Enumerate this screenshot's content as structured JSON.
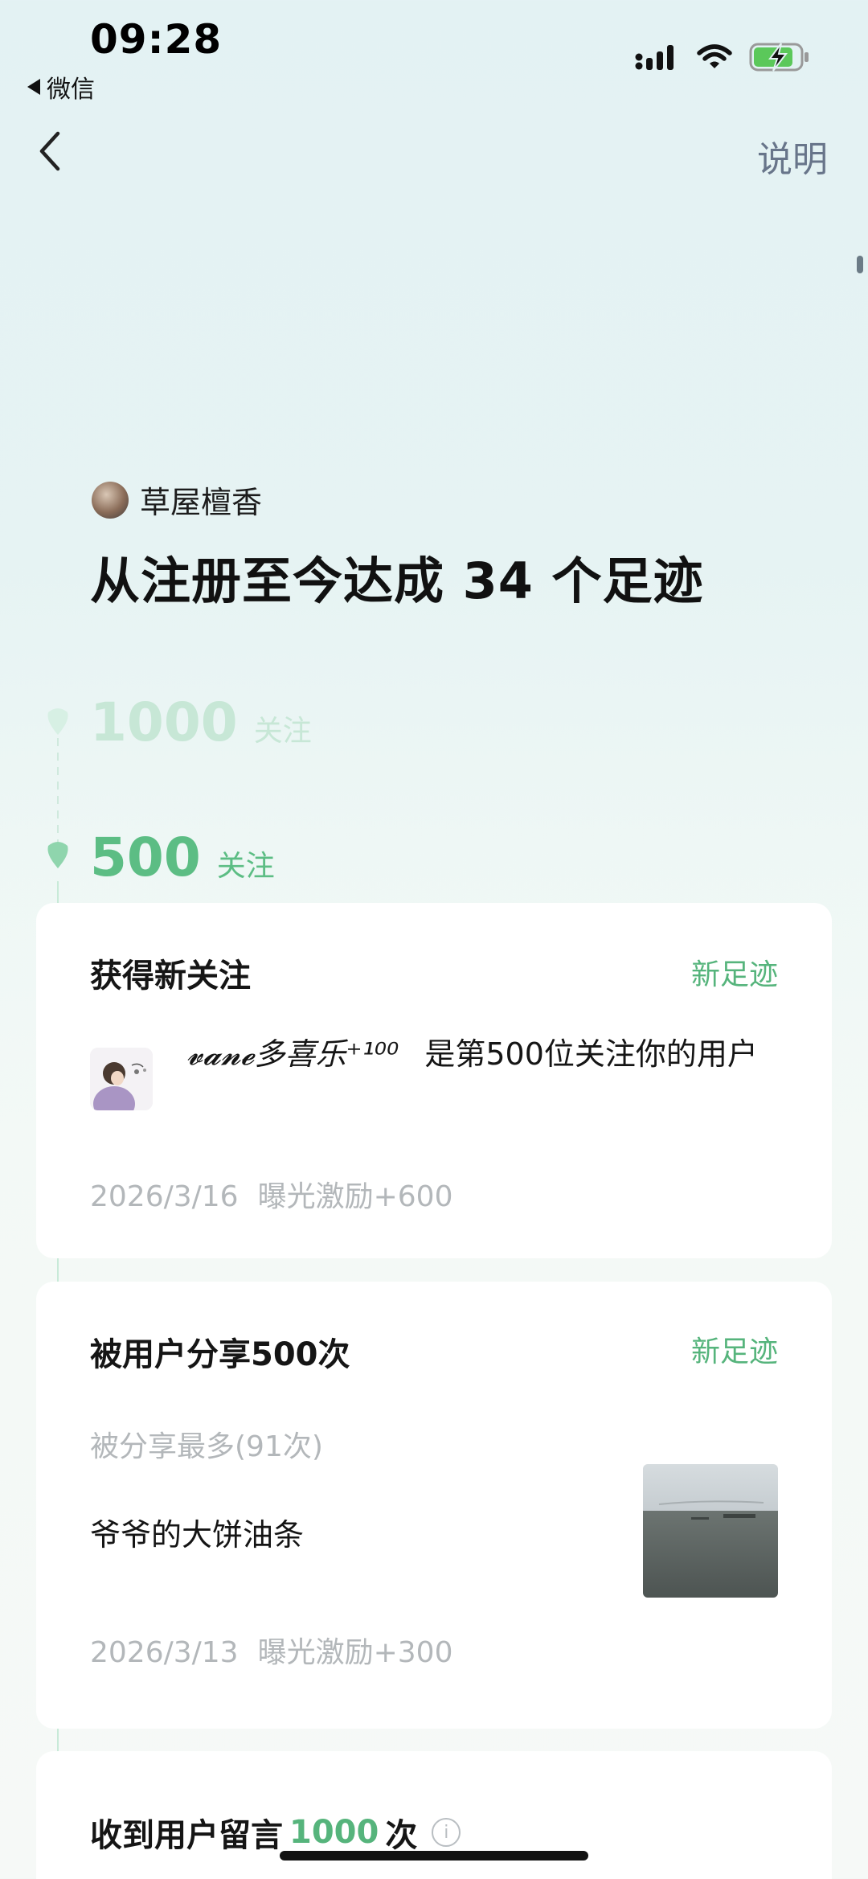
{
  "status_bar": {
    "time": "09:28",
    "back_app": "微信",
    "icons": [
      "signal-icon",
      "wifi-icon",
      "battery-charging-icon"
    ]
  },
  "nav": {
    "back_icon": "chevron-left-icon",
    "help_label": "说明"
  },
  "header": {
    "user_name": "草屋檀香",
    "headline": "从注册至今达成 34 个足迹"
  },
  "milestones": [
    {
      "number": "1000",
      "unit": "关注",
      "state": "upcoming"
    },
    {
      "number": "500",
      "unit": "关注",
      "state": "achieved"
    }
  ],
  "cards": {
    "new_follower": {
      "title": "获得新关注",
      "tag": "新足迹",
      "nickname": "𝓿𝓪𝓷𝓮多喜乐⁺¹⁰⁰",
      "description": "是第500位关注你的用户",
      "date": "2026/3/16",
      "reward": "曝光激励+600"
    },
    "shares": {
      "title": "被用户分享500次",
      "tag": "新足迹",
      "sub_label": "被分享最多(91次)",
      "post_title": "爷爷的大饼油条",
      "date": "2026/3/13",
      "reward": "曝光激励+300"
    },
    "comments": {
      "title_prefix": "收到用户留言",
      "count": "1000",
      "title_suffix": "次",
      "info_icon": "i"
    }
  },
  "colors": {
    "accent_green": "#56b47c",
    "milestone_green": "#5cbd84",
    "faded_green": "#c7e7d6",
    "muted_text": "#b3b7ba",
    "help_text": "#68758a"
  }
}
